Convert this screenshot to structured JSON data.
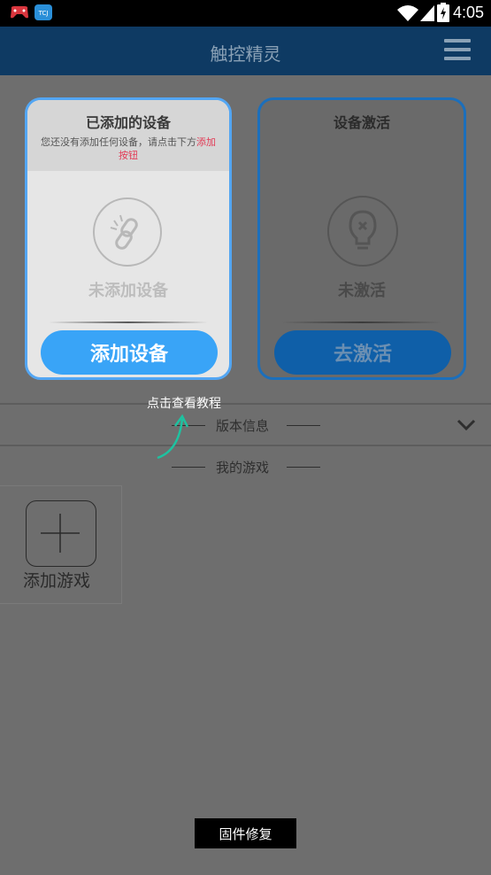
{
  "status_bar": {
    "time": "4:05",
    "icons": [
      "game-controller-icon",
      "app-icon",
      "wifi-icon",
      "signal-icon",
      "battery-icon"
    ]
  },
  "header": {
    "title": "触控精灵",
    "menu_icon": "menu-icon"
  },
  "device_card": {
    "title": "已添加的设备",
    "desc_text": "您还没有添加任何设备，请点击下方",
    "desc_link": "添加按钮",
    "status": "未添加设备",
    "button": "添加设备",
    "icon": "broken-link-icon"
  },
  "activation_card": {
    "title": "设备激活",
    "status": "未激活",
    "button": "去激活",
    "icon": "lightbulb-icon"
  },
  "tutorial_hint": "点击查看教程",
  "version_section": "版本信息",
  "games_section": "我的游戏",
  "add_game_label": "添加游戏",
  "firmware_button": "固件修复",
  "colors": {
    "accent": "#39a4f7",
    "header": "#0e3a63",
    "link": "#e23a55"
  }
}
